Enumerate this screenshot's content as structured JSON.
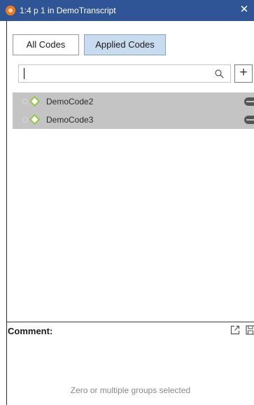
{
  "window": {
    "title": "1:4 p 1 in DemoTranscript",
    "close_glyph": "✕",
    "app_icon": "app-logo-icon"
  },
  "tabs": [
    {
      "label": "All Codes",
      "selected": false
    },
    {
      "label": "Applied Codes",
      "selected": true
    }
  ],
  "search": {
    "value": "",
    "placeholder": "",
    "icon": "search-icon",
    "add_glyph": "+"
  },
  "codes": [
    {
      "name": "DemoCode2",
      "color": "#8dc63f",
      "icon": "diamond-icon"
    },
    {
      "name": "DemoCode3",
      "color": "#8dc63f",
      "icon": "diamond-icon"
    }
  ],
  "comment": {
    "label": "Comment:",
    "message": "Zero or multiple groups selected"
  },
  "colors": {
    "titlebar": "#2f5597",
    "selected_tab": "#c9dcef",
    "list_background": "#c4c4c4",
    "code_color": "#8dc63f"
  }
}
